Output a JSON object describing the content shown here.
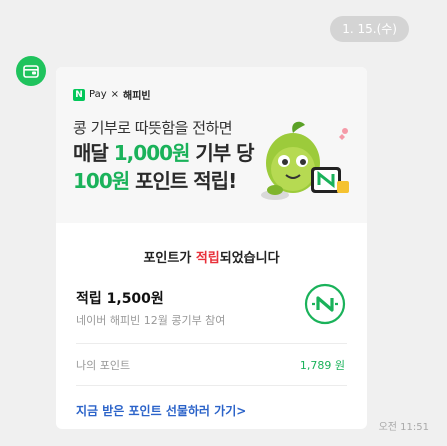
{
  "date_pill": "1. 15.(수)",
  "sender": {
    "avatar_icon": "wallet-icon",
    "color": "#1fc35d"
  },
  "banner": {
    "brand_n": "N",
    "brand_pay": "Pay",
    "brand_x": "×",
    "brand_partner": "해피빈",
    "line1": "콩 기부로 따뜻함을 전하면",
    "line2_a": "매달 ",
    "line2_b": "1,000원",
    "line2_c": " 기부 당",
    "line3_a": "100원",
    "line3_b": " 포인트 적립!",
    "mascot_icon": "bean-mascot-icon"
  },
  "receipt": {
    "title_a": "포인트가 ",
    "title_b": "적립",
    "title_c": "되었습니다",
    "amount": "적립 1,500원",
    "description": "네이버 해피빈 12월 콩기부 참여",
    "logo_icon": "naver-pay-n-icon",
    "my_point_label": "나의 포인트",
    "my_point_value": "1,789 원",
    "link": "지금 받은 포인트 선물하러 가기>"
  },
  "timestamp": "오전 11:51",
  "colors": {
    "accent_green": "#1ab25a",
    "accent_red": "#e8303a",
    "link_blue": "#2b63c9"
  }
}
